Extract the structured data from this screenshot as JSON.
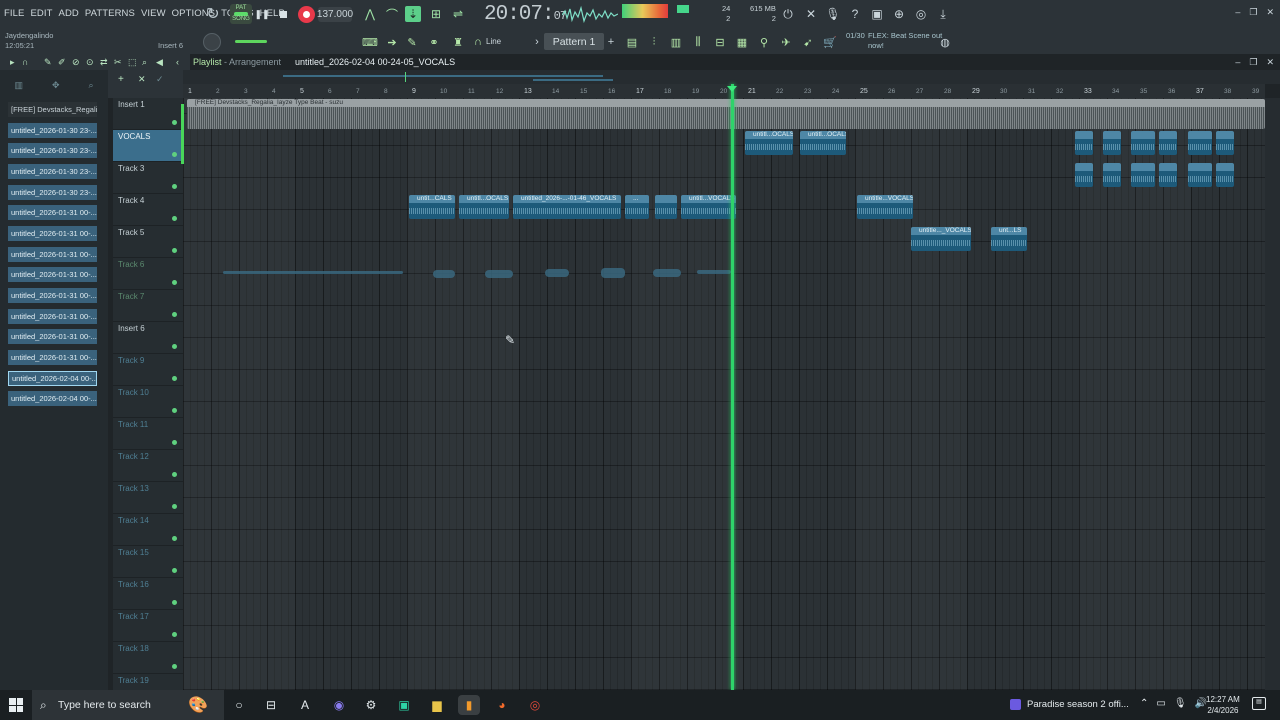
{
  "menu": [
    "FILE",
    "EDIT",
    "ADD",
    "PATTERNS",
    "VIEW",
    "OPTIONS",
    "TOOLS",
    "HELP"
  ],
  "transport": {
    "pat_song": "SONG",
    "pat_label": "PAT",
    "tempo": "137.000",
    "time_main": "20:07",
    "time_sub": "07",
    "time_bst": "B:S:T",
    "cpu": "24",
    "cpu_sub": "2",
    "mem": "615 MB",
    "mem_sub": "2"
  },
  "user": {
    "name": "Jaydengalindo",
    "time": "12:05:21"
  },
  "mixer": {
    "insert": "Insert 6"
  },
  "toolbar": {
    "snap_mode": "Line",
    "pattern": "Pattern 1",
    "hint_counter": "01/30",
    "hint_text": "FLEX: Beat Scene out now!"
  },
  "browser": {
    "items": [
      "[FREE] Devstacks_Regalia_",
      "untitled_2026-01-30 23-...",
      "untitled_2026-01-30 23-...",
      "untitled_2026-01-30 23-...",
      "untitled_2026-01-30 23-...",
      "untitled_2026-01-31 00-...",
      "untitled_2026-01-31 00-...",
      "untitled_2026-01-31 00-...",
      "untitled_2026-01-31 00-...",
      "untitled_2026-01-31 00-...",
      "untitled_2026-01-31 00-...",
      "untitled_2026-01-31 00-...",
      "untitled_2026-01-31 00-...",
      "untitled_2026-02-04 00-...",
      "untitled_2026-02-04 00-..."
    ]
  },
  "playlist": {
    "title": "Playlist",
    "subtitle": "- Arrangement",
    "file": "untitled_2026-02-04 00-24-05_VOCALS"
  },
  "ruler": [
    "1",
    "2",
    "3",
    "4",
    "5",
    "6",
    "7",
    "8",
    "9",
    "10",
    "11",
    "12",
    "13",
    "14",
    "15",
    "16",
    "17",
    "18",
    "19",
    "20",
    "21",
    "22",
    "23",
    "24",
    "25",
    "26",
    "27",
    "28",
    "29",
    "30",
    "31",
    "32",
    "33",
    "34",
    "35",
    "36",
    "37",
    "38",
    "39"
  ],
  "tracks": [
    "Insert 1",
    "VOCALS",
    "Track 3",
    "Track 4",
    "Track 5",
    "Track 6",
    "Track 7",
    "Insert 6",
    "Track 9",
    "Track 10",
    "Track 11",
    "Track 12",
    "Track 13",
    "Track 14",
    "Track 15",
    "Track 16",
    "Track 17",
    "Track 18",
    "Track 19"
  ],
  "clips": {
    "beat": "[FREE] Devstacks_Regalia_Iayze Type Beat - suzu",
    "v1": "untitl...OCALS",
    "v2": "untitl...OCALS",
    "t4a": "untit...CALS",
    "t4b": "untitl...OCALS",
    "t4c": "untitled_2026-...-01-46_VOCALS",
    "t4d": "...",
    "t4e": "",
    "t4f": "untitl...VOCALS",
    "t4g": "untitle...VOCALS",
    "t5a": "untitle..._VOCALS",
    "t5b": "unt...LS"
  },
  "taskbar": {
    "search_placeholder": "Type here to search",
    "media": "Paradise season 2 offi...",
    "time": "12:27 AM",
    "date": "2/4/2026"
  }
}
